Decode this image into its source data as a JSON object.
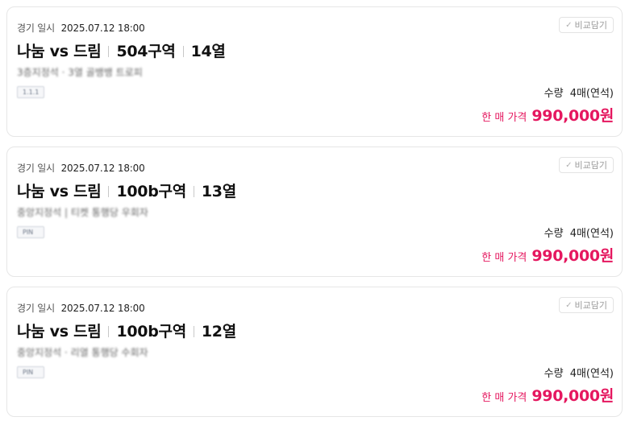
{
  "listings": [
    {
      "date_label": "경기 일시",
      "date_value": "2025.07.12 18:00",
      "compare_label": "비교담기",
      "match": "나눔 vs 드림",
      "section": "504구역",
      "row": "14열",
      "blurred_info": "3층지정석 · 3열 골뱅뱅 트로피",
      "blurred_tag": "1.1.1",
      "qty_label": "수량",
      "qty_value": "4매(연석)",
      "price_label": "한 매 가격",
      "price_value": "990,000원"
    },
    {
      "date_label": "경기 일시",
      "date_value": "2025.07.12 18:00",
      "compare_label": "비교담기",
      "match": "나눔 vs 드림",
      "section": "100b구역",
      "row": "13열",
      "blurred_info": "중앙지정석 | 티켓 통행당 우회자",
      "blurred_tag": "PIN",
      "qty_label": "수량",
      "qty_value": "4매(연석)",
      "price_label": "한 매 가격",
      "price_value": "990,000원"
    },
    {
      "date_label": "경기 일시",
      "date_value": "2025.07.12 18:00",
      "compare_label": "비교담기",
      "match": "나눔 vs 드림",
      "section": "100b구역",
      "row": "12열",
      "blurred_info": "중앙지정석 · 리열 통행당 수회자",
      "blurred_tag": "PIN",
      "qty_label": "수량",
      "qty_value": "4매(연석)",
      "price_label": "한 매 가격",
      "price_value": "990,000원"
    }
  ],
  "icons": {
    "compare": "check-icon"
  },
  "colors": {
    "accent": "#e5175f",
    "border": "#e6e6e6"
  }
}
